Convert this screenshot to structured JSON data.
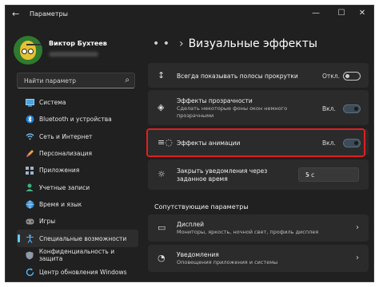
{
  "window": {
    "back_glyph": "←",
    "title": "Параметры",
    "controls": [
      "—",
      "☐",
      "✕"
    ]
  },
  "user": {
    "name": "Виктор Бухтеев"
  },
  "search": {
    "placeholder": "Найти параметр"
  },
  "sidebar": {
    "items": [
      {
        "label": "Система",
        "icon": "monitor-icon"
      },
      {
        "label": "Bluetooth и устройства",
        "icon": "bluetooth-icon"
      },
      {
        "label": "Сеть и Интернет",
        "icon": "wifi-icon"
      },
      {
        "label": "Персонализация",
        "icon": "brush-icon"
      },
      {
        "label": "Приложения",
        "icon": "apps-icon"
      },
      {
        "label": "Учетные записи",
        "icon": "person-icon"
      },
      {
        "label": "Время и язык",
        "icon": "globe-icon"
      },
      {
        "label": "Игры",
        "icon": "gamepad-icon"
      },
      {
        "label": "Специальные возможности",
        "icon": "accessibility-icon"
      },
      {
        "label": "Конфиденциальность и защита",
        "icon": "shield-icon"
      },
      {
        "label": "Центр обновления Windows",
        "icon": "update-icon"
      }
    ],
    "active_index": 8
  },
  "breadcrumb": {
    "dots": "• •",
    "separator": "›",
    "title": "Визуальные эффекты"
  },
  "settings": {
    "scrollbars": {
      "title": "Всегда показывать полосы прокрутки",
      "state": "Откл.",
      "on": false
    },
    "transparency": {
      "title": "Эффекты прозрачности",
      "subtitle": "Сделать некоторые фоны окон немного прозрачными",
      "state": "Вкл.",
      "on": true
    },
    "animation": {
      "title": "Эффекты анимации",
      "state": "Вкл.",
      "on": true
    },
    "notifications": {
      "title": "Закрыть уведомления через заданное время",
      "value": "5 с"
    }
  },
  "related": {
    "heading": "Сопутствующие параметры",
    "items": [
      {
        "title": "Дисплей",
        "subtitle": "Мониторы, яркость, ночной свет, профиль дисплея"
      },
      {
        "title": "Уведомления",
        "subtitle": "Оповещения приложения и системы"
      }
    ]
  },
  "colors": {
    "accent": "#60cdff",
    "highlight": "#e02020"
  }
}
